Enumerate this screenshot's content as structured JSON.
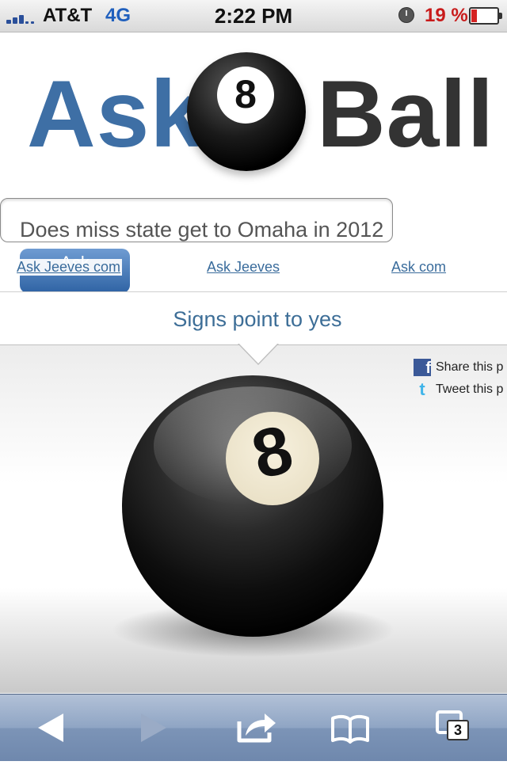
{
  "status_bar": {
    "carrier": "AT&T",
    "network": "4G",
    "time": "2:22 PM",
    "battery_percent": "19 %"
  },
  "logo": {
    "word_left": "Ask",
    "ball_number": "8",
    "word_right": "Ball"
  },
  "question": {
    "value": "Does miss state get to Omaha in 2012"
  },
  "ask_button": {
    "label": "Ask"
  },
  "links": [
    {
      "label": "Ask Jeeves com"
    },
    {
      "label": "Ask Jeeves"
    },
    {
      "label": "Ask com"
    }
  ],
  "answer": {
    "text": "Signs point to yes"
  },
  "main_ball": {
    "number": "8"
  },
  "share": {
    "facebook_label": "Share this p",
    "twitter_label": "Tweet this p",
    "facebook_icon": "f",
    "twitter_icon": "t"
  },
  "toolbar": {
    "tabs_count": "3"
  },
  "colors": {
    "logo_blue": "#3e6fa5",
    "link_blue": "#3a6c9c",
    "battery_red": "#c81b1b",
    "toolbar_blue": "#7c94b7"
  }
}
